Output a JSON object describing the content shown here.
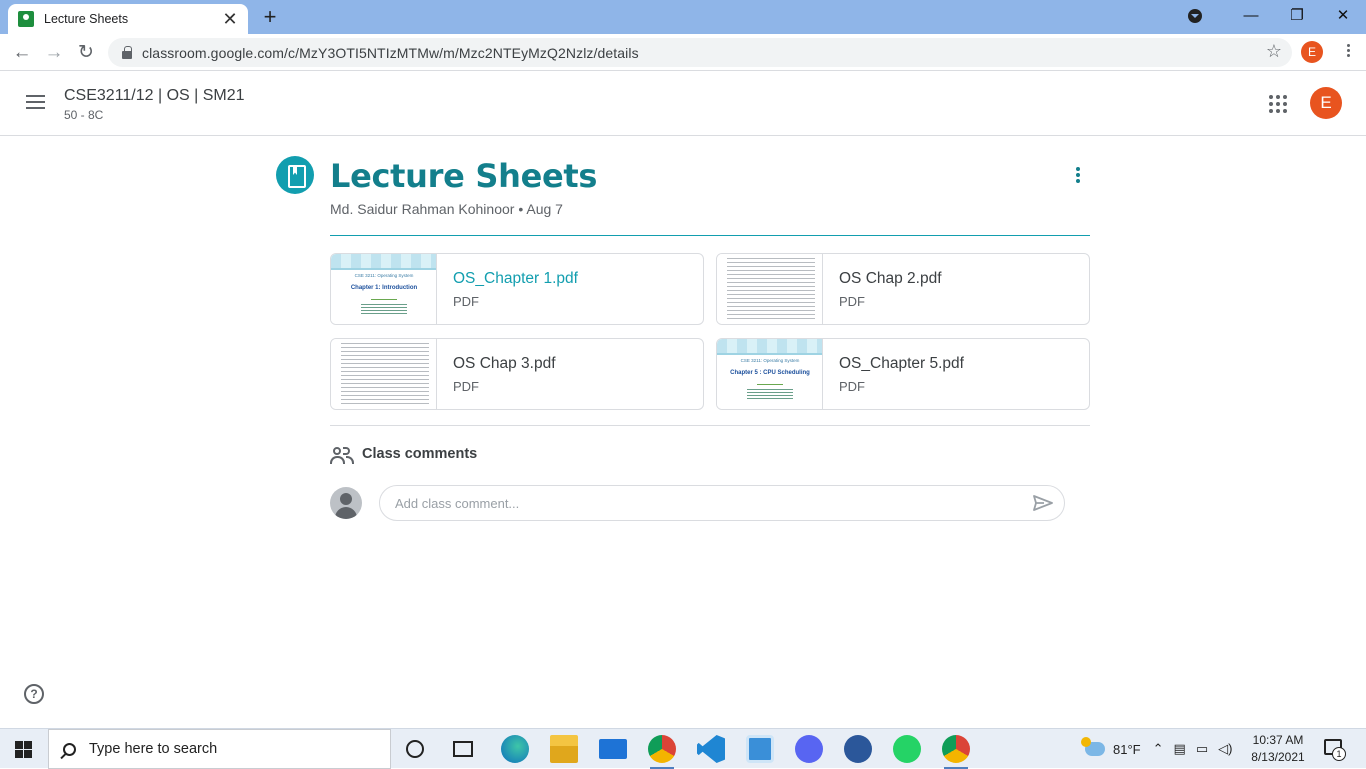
{
  "browser": {
    "tab_title": "Lecture Sheets",
    "tab_close": "✕",
    "new_tab": "+",
    "url": "classroom.google.com/c/MzY3OTI5NTIzMTMw/m/Mzc2NTEyMzQ2Nzlz/details",
    "profile_initial": "E",
    "window_controls": {
      "minimize": "—",
      "restore": "❐",
      "close": "✕"
    },
    "nav": {
      "back": "←",
      "forward": "→",
      "reload": "↻",
      "bookmark": "☆"
    }
  },
  "header": {
    "class_name": "CSE3211/12 | OS | SM21",
    "section": "50 - 8C",
    "avatar_initial": "E"
  },
  "material": {
    "title": "Lecture Sheets",
    "author": "Md. Saidur Rahman Kohinoor",
    "separator": "•",
    "date": "Aug 7"
  },
  "attachments": [
    {
      "name": "OS_Chapter 1.pdf",
      "type": "PDF",
      "thumb_kind": "cover",
      "thumb_head": "CSE 3211: Operating System",
      "thumb_chapter": "Chapter 1:  Introduction"
    },
    {
      "name": "OS Chap 2.pdf",
      "type": "PDF",
      "thumb_kind": "text"
    },
    {
      "name": "OS Chap 3.pdf",
      "type": "PDF",
      "thumb_kind": "text"
    },
    {
      "name": "OS_Chapter 5.pdf",
      "type": "PDF",
      "thumb_kind": "cover",
      "thumb_head": "CSE 3211: Operating System",
      "thumb_chapter": "Chapter 5 : CPU Scheduling"
    }
  ],
  "comments": {
    "title": "Class comments",
    "placeholder": "Add class comment..."
  },
  "help": {
    "glyph": "?"
  },
  "taskbar": {
    "search_placeholder": "Type here to search",
    "temperature": "81°F",
    "time": "10:37 AM",
    "date": "8/13/2021",
    "notification_count": "1",
    "apps": [
      "edge-icon",
      "file-explorer-icon",
      "mail-icon",
      "chrome-icon",
      "vscode-icon",
      "control-panel-icon",
      "discord-icon",
      "word-icon",
      "whatsapp-icon",
      "chrome-profile-icon"
    ]
  },
  "colors": {
    "accent": "#129eaf",
    "title_teal": "#137f8c",
    "avatar": "#e8541f",
    "chrome_tabstrip": "#8fb5e8"
  }
}
